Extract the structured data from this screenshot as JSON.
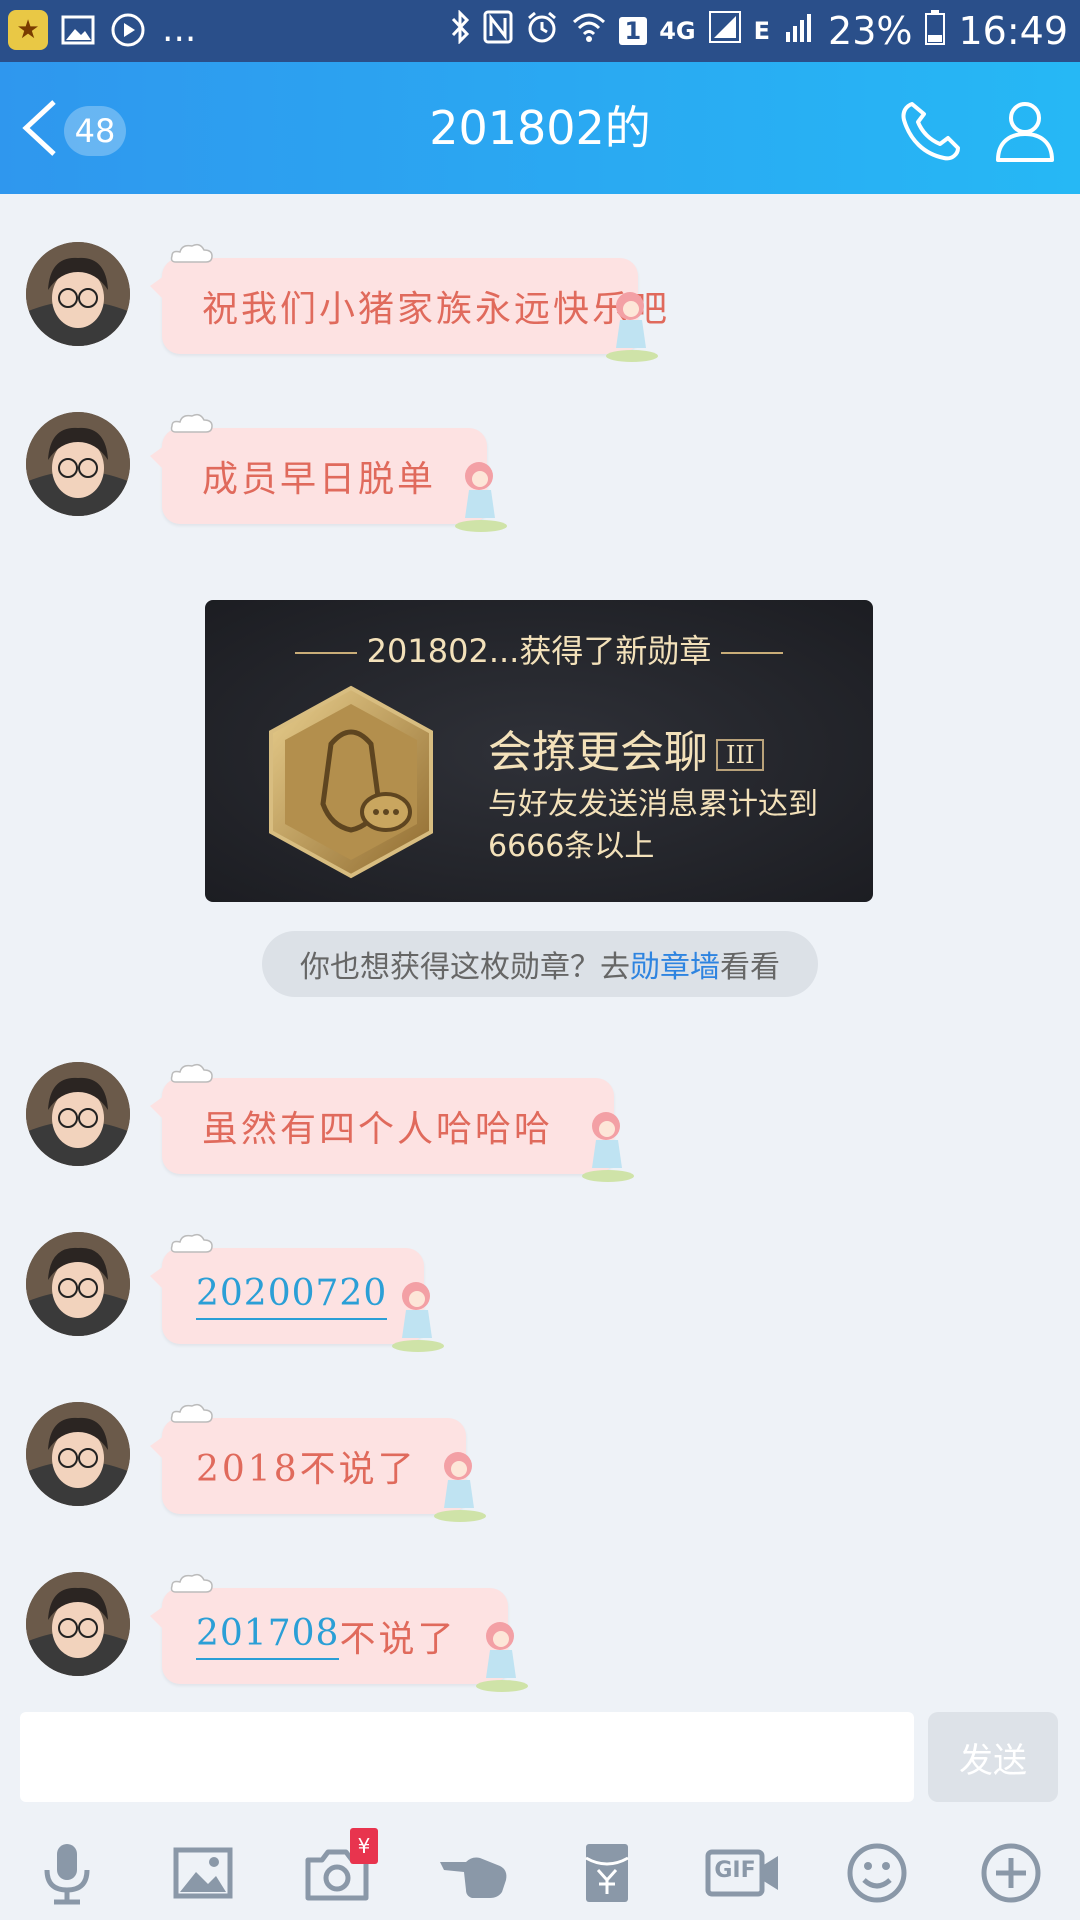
{
  "status_bar": {
    "sim_slot": "1",
    "network": "4G",
    "network2": "E",
    "battery": "23%",
    "time": "16:49",
    "overflow": "..."
  },
  "header": {
    "title": "201802的",
    "unread_count": "48"
  },
  "messages": [
    {
      "text": "祝我们小猪家族永远快乐吧"
    },
    {
      "text": "成员早日脱单"
    },
    {
      "text": "虽然有四个人哈哈哈"
    },
    {
      "text": "20200720"
    },
    {
      "text": "2018不说了"
    },
    {
      "link": "201708",
      "text": "不说了"
    }
  ],
  "medal_card": {
    "header": "201802...获得了新勋章",
    "name": "会撩更会聊",
    "level": "III",
    "description": "与好友发送消息累计达到6666条以上"
  },
  "medal_prompt": {
    "prefix": "你也想获得这枚勋章？去",
    "link": "勋章墙",
    "suffix": "看看"
  },
  "input": {
    "send_label": "发送"
  },
  "toolbar": {
    "items": [
      "voice-icon",
      "image-icon",
      "camera-icon",
      "poke-icon",
      "red-packet-icon",
      "gif-icon",
      "emoji-icon",
      "plus-icon"
    ],
    "camera_badge": "¥",
    "gif_label": "GIF"
  }
}
